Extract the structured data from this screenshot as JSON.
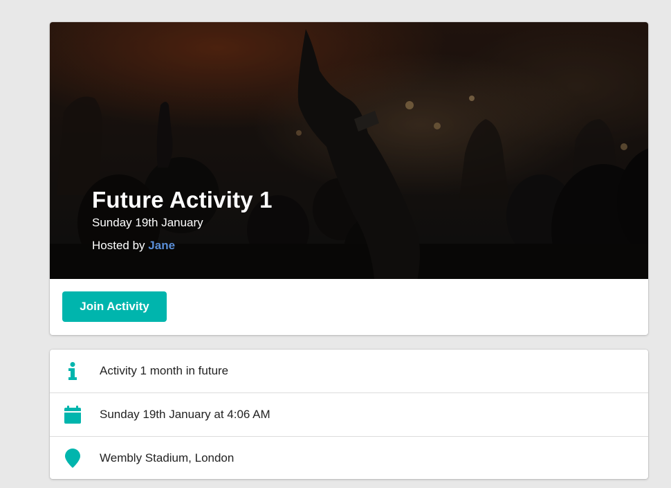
{
  "activity": {
    "title": "Future Activity 1",
    "date": "Sunday 19th January",
    "hosted_by_label": "Hosted by",
    "host_name": "Jane",
    "join_button": "Join Activity"
  },
  "details": [
    {
      "icon": "info-icon",
      "text": "Activity 1 month in future"
    },
    {
      "icon": "calendar-icon",
      "text": "Sunday 19th January at 4:06 AM"
    },
    {
      "icon": "map-marker-icon",
      "text": "Wembly Stadium, London"
    }
  ],
  "colors": {
    "accent": "#00b5ad",
    "host_link": "#5b8fd8",
    "page_background": "#e8e8e8"
  }
}
